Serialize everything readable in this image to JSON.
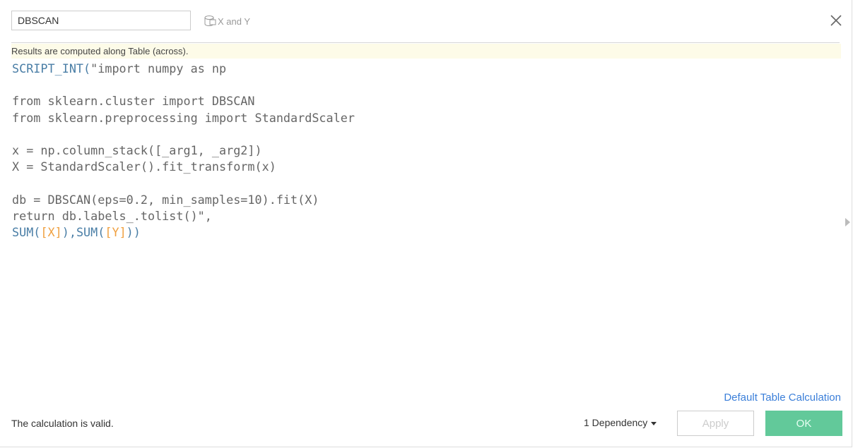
{
  "calc_name": "DBSCAN",
  "dependency_fields": "X and Y",
  "info_bar": "Results are computed along Table (across).",
  "code_lines": [
    [
      {
        "t": "SCRIPT_INT(",
        "c": "fn"
      },
      {
        "t": "\"import numpy as np",
        "c": ""
      }
    ],
    [],
    [
      {
        "t": "from sklearn.cluster import DBSCAN",
        "c": ""
      }
    ],
    [
      {
        "t": "from sklearn.preprocessing import StandardScaler",
        "c": ""
      }
    ],
    [],
    [
      {
        "t": "x = np.column_stack([_arg1, _arg2])",
        "c": ""
      }
    ],
    [
      {
        "t": "X = StandardScaler().fit_transform(x)",
        "c": ""
      }
    ],
    [],
    [
      {
        "t": "db = DBSCAN(eps=0.2, min_samples=10).fit(X)",
        "c": ""
      }
    ],
    [
      {
        "t": "return db.labels_.tolist()\",",
        "c": ""
      }
    ],
    [
      {
        "t": "SUM(",
        "c": "fn"
      },
      {
        "t": "[X]",
        "c": "fld"
      },
      {
        "t": "),SUM(",
        "c": "fn"
      },
      {
        "t": "[Y]",
        "c": "fld"
      },
      {
        "t": "))",
        "c": "fn"
      }
    ]
  ],
  "footer": {
    "default_table_calc": "Default Table Calculation",
    "status": "The calculation is valid.",
    "dependency": "1 Dependency",
    "apply": "Apply",
    "ok": "OK"
  },
  "colors": {
    "function": "#4a7ea6",
    "field": "#f0a040",
    "ok_button": "#62c99a",
    "link": "#3b7fd9"
  }
}
